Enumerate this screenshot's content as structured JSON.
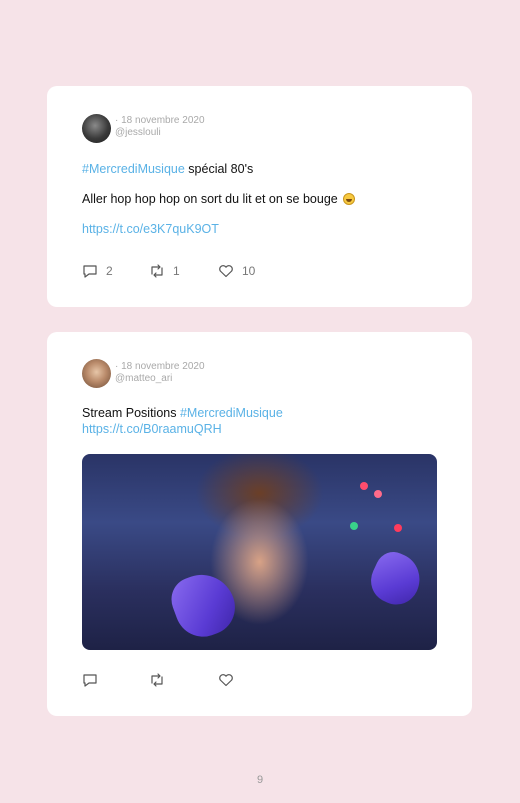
{
  "tweets": [
    {
      "date": "· 18 novembre 2020",
      "handle": "@jesslouli",
      "line1_hashtag": "#MercrediMusique",
      "line1_rest": " spécial 80's",
      "line2": "Aller hop hop hop on sort du lit et on se bouge",
      "link": "https://t.co/e3K7quK9OT",
      "reply_count": "2",
      "retweet_count": "1",
      "like_count": "10"
    },
    {
      "date": "· 18 novembre 2020",
      "handle": "@matteo_ari",
      "line1_text": "Stream Positions ",
      "line1_hashtag": "#MercrediMusique",
      "link": "https://t.co/B0raamuQRH",
      "reply_count": "",
      "retweet_count": "",
      "like_count": ""
    }
  ],
  "page_number": "9",
  "colors": {
    "background": "#f6e3e8",
    "link": "#5ab2e6"
  }
}
